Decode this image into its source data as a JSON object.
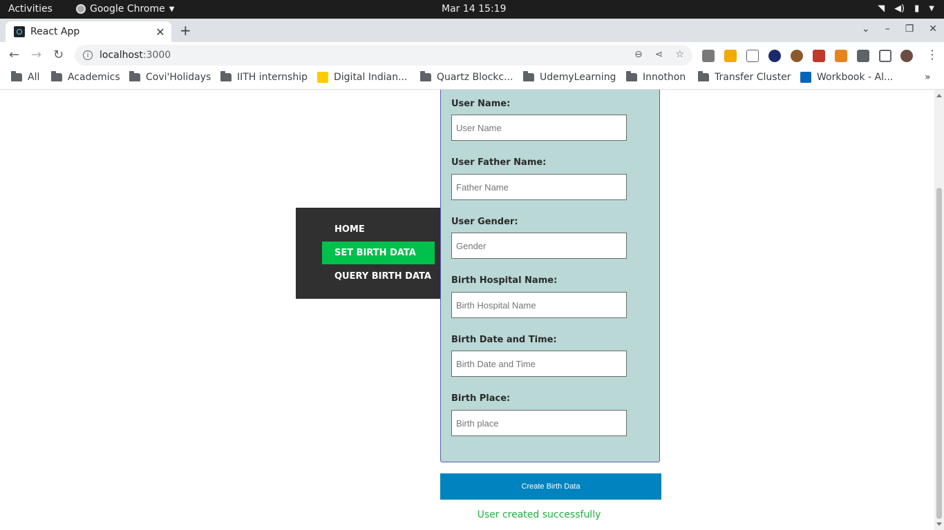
{
  "os": {
    "activities": "Activities",
    "app_menu": "Google Chrome",
    "clock": "Mar 14  15:19"
  },
  "browser": {
    "tab_title": "React App",
    "url_host": "localhost",
    "url_port": ":3000",
    "bookmarks": [
      {
        "label": "All",
        "icon": "folder-icon"
      },
      {
        "label": "Academics",
        "icon": "folder-icon"
      },
      {
        "label": "Covi'Holidays",
        "icon": "folder-icon"
      },
      {
        "label": "IITH internship",
        "icon": "folder-icon"
      },
      {
        "label": "Digital Indian...",
        "icon": "site-icon"
      },
      {
        "label": "Quartz Blockc...",
        "icon": "folder-icon"
      },
      {
        "label": "UdemyLearning",
        "icon": "folder-icon"
      },
      {
        "label": "Innothon",
        "icon": "folder-icon"
      },
      {
        "label": "Transfer Cluster",
        "icon": "folder-icon"
      },
      {
        "label": "Workbook - Al...",
        "icon": "sharepoint-icon"
      }
    ],
    "more_bookmarks": "»"
  },
  "nav": {
    "items": [
      {
        "label": "HOME",
        "active": false
      },
      {
        "label": "SET BIRTH DATA",
        "active": true
      },
      {
        "label": "QUERY BIRTH DATA",
        "active": false
      }
    ]
  },
  "form": {
    "fields": [
      {
        "label": "User Name:",
        "placeholder": "User Name",
        "value": ""
      },
      {
        "label": "User Father Name:",
        "placeholder": "Father Name",
        "value": ""
      },
      {
        "label": "User Gender:",
        "placeholder": "Gender",
        "value": ""
      },
      {
        "label": "Birth Hospital Name:",
        "placeholder": "Birth Hospital Name",
        "value": ""
      },
      {
        "label": "Birth Date and Time:",
        "placeholder": "Birth Date and Time",
        "value": ""
      },
      {
        "label": "Birth Place:",
        "placeholder": "Birth place",
        "value": ""
      }
    ],
    "submit_label": "Create Birth Data",
    "status_message": "User created successfully"
  },
  "colors": {
    "nav_bg": "#303030",
    "nav_active": "#00c14c",
    "form_bg": "#b9d8d6",
    "button_bg": "#0083bf",
    "success_text": "#1eb13c"
  }
}
